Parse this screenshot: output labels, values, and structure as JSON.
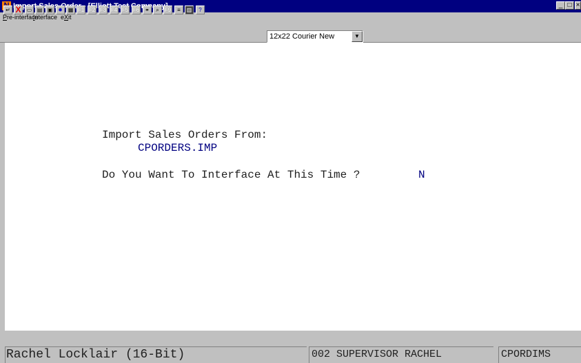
{
  "window": {
    "title": "Import Sales Order - [Elliott Test Company]",
    "icon": "app-logo-icon",
    "app_icon_glyph": "N"
  },
  "menu": {
    "items": [
      "Pre-interface",
      "Interface",
      "eXit"
    ]
  },
  "toolbar": {
    "buttons": [
      "enter-icon",
      "cancel-x-icon",
      "cut-icon",
      "copy-icon",
      "paste-icon",
      "settings-icon",
      "calculator-icon",
      "F1",
      "F2",
      "F3",
      "F4",
      "F5",
      "F6",
      "binoculars-icon",
      "zoom-icon",
      "F9",
      "notes-icon",
      "calendar-icon",
      "help-icon"
    ],
    "font_select": {
      "value": "12x22 Courier New"
    }
  },
  "screen": {
    "import_label": "Import Sales Orders From:",
    "import_file": "CPORDERS.IMP",
    "interface_prompt": "Do You Want To Interface At This Time ?",
    "interface_answer": "N"
  },
  "status": {
    "user": "Rachel Locklair (16-Bit)",
    "operator": "002 SUPERVISOR RACHEL",
    "program": "CPORDIMS"
  }
}
